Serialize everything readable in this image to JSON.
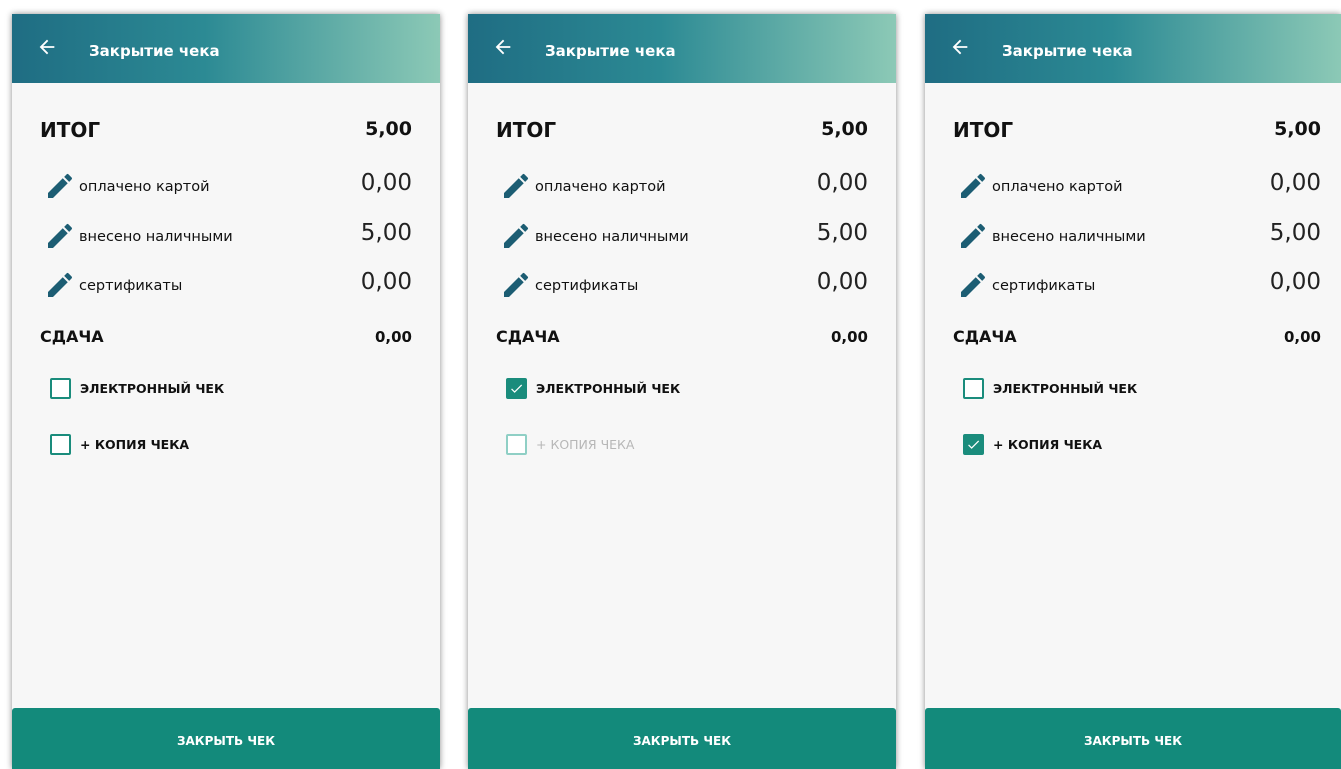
{
  "accent_color": "#138a7b",
  "header_gradient": [
    "#1f6d83",
    "#8cc9b6"
  ],
  "screens": [
    {
      "title": "Закрытие чека",
      "total": {
        "label": "ИТОГ",
        "value": "5,00"
      },
      "payments": [
        {
          "label": "оплачено картой",
          "value": "0,00",
          "icon": "pencil-icon"
        },
        {
          "label": "внесено наличными",
          "value": "5,00",
          "icon": "pencil-icon"
        },
        {
          "label": "сертификаты",
          "value": "0,00",
          "icon": "pencil-icon"
        }
      ],
      "change": {
        "label": "СДАЧА",
        "value": "0,00"
      },
      "options": [
        {
          "label": "ЭЛЕКТРОННЫЙ ЧЕК",
          "checked": false,
          "disabled": false
        },
        {
          "label": "+ КОПИЯ ЧЕКА",
          "checked": false,
          "disabled": false
        }
      ],
      "close_button": "ЗАКРЫТЬ ЧЕК"
    },
    {
      "title": "Закрытие чека",
      "total": {
        "label": "ИТОГ",
        "value": "5,00"
      },
      "payments": [
        {
          "label": "оплачено картой",
          "value": "0,00",
          "icon": "pencil-icon"
        },
        {
          "label": "внесено наличными",
          "value": "5,00",
          "icon": "pencil-icon"
        },
        {
          "label": "сертификаты",
          "value": "0,00",
          "icon": "pencil-icon"
        }
      ],
      "change": {
        "label": "СДАЧА",
        "value": "0,00"
      },
      "options": [
        {
          "label": "ЭЛЕКТРОННЫЙ ЧЕК",
          "checked": true,
          "disabled": false
        },
        {
          "label": "+ КОПИЯ ЧЕКА",
          "checked": false,
          "disabled": true
        }
      ],
      "close_button": "ЗАКРЫТЬ ЧЕК"
    },
    {
      "title": "Закрытие чека",
      "total": {
        "label": "ИТОГ",
        "value": "5,00"
      },
      "payments": [
        {
          "label": "оплачено картой",
          "value": "0,00",
          "icon": "pencil-icon"
        },
        {
          "label": "внесено наличными",
          "value": "5,00",
          "icon": "pencil-icon"
        },
        {
          "label": "сертификаты",
          "value": "0,00",
          "icon": "pencil-icon"
        }
      ],
      "change": {
        "label": "СДАЧА",
        "value": "0,00"
      },
      "options": [
        {
          "label": "ЭЛЕКТРОННЫЙ ЧЕК",
          "checked": false,
          "disabled": false
        },
        {
          "label": "+ КОПИЯ ЧЕКА",
          "checked": true,
          "disabled": false
        }
      ],
      "close_button": "ЗАКРЫТЬ ЧЕК"
    }
  ]
}
